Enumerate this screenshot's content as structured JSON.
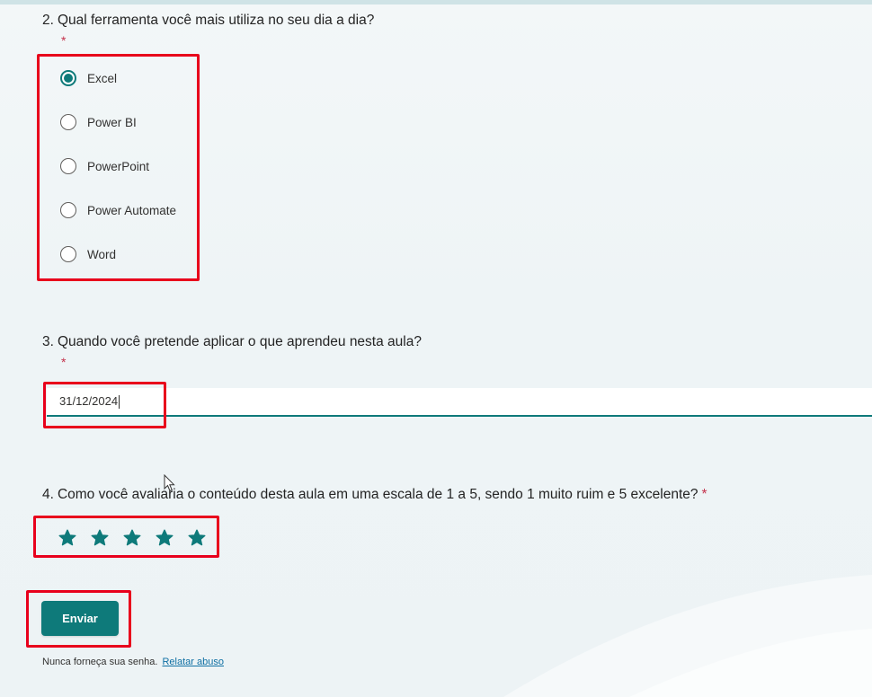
{
  "questions": [
    {
      "number": "2.",
      "title": "Qual ferramenta você mais utiliza no seu dia a dia?",
      "required_mark": "*",
      "type": "radio",
      "selected": "Excel",
      "options": [
        "Excel",
        "Power BI",
        "PowerPoint",
        "Power Automate",
        "Word"
      ]
    },
    {
      "number": "3.",
      "title": "Quando você pretende aplicar o que aprendeu nesta aula?",
      "required_mark": "*",
      "type": "date",
      "value": "31/12/2024"
    },
    {
      "number": "4.",
      "title": "Como você avaliaria o conteúdo desta aula em uma escala de 1 a 5, sendo 1 muito ruim e 5 excelente?",
      "required_mark": "*",
      "type": "rating",
      "max_rating": 5,
      "rating": 5
    }
  ],
  "submit_label": "Enviar",
  "footer": {
    "notice": "Nunca forneça sua senha.",
    "report_link": "Relatar abuso"
  },
  "colors": {
    "accent": "#0e7a7a",
    "highlight": "#e8001c",
    "required": "#c4314b",
    "link": "#0e6fa3"
  }
}
